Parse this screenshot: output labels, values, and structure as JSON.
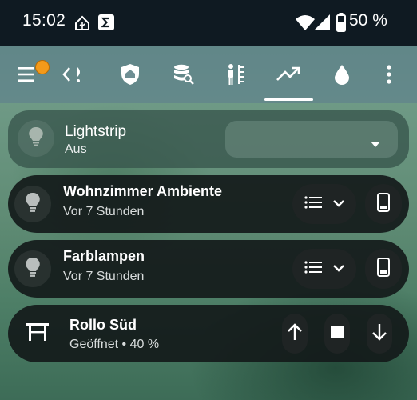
{
  "status_bar": {
    "time": "15:02",
    "battery_text": "50 %",
    "icons": [
      "home-assistant-icon",
      "sigma-app-icon",
      "wifi-icon",
      "cellular-signal-icon",
      "battery-icon"
    ]
  },
  "app_bar": {
    "tabs": [
      {
        "icon": "menu-icon",
        "has_badge": true
      },
      {
        "icon": "chevron-left-tab-icon"
      },
      {
        "icon": "shield-home-icon"
      },
      {
        "icon": "database-search-icon"
      },
      {
        "icon": "human-icon"
      },
      {
        "icon": "trending-up-icon",
        "selected": true
      },
      {
        "icon": "water-drop-icon"
      },
      {
        "icon": "more-vertical-icon"
      }
    ]
  },
  "cards": {
    "lightstrip": {
      "title": "Lightstrip",
      "state": "Aus",
      "dropdown_value": ""
    },
    "wohnzimmer": {
      "title": "Wohnzimmer Ambiente",
      "subtitle": "Vor 7 Stunden"
    },
    "farblampen": {
      "title": "Farblampen",
      "subtitle": "Vor 7 Stunden"
    },
    "rollo": {
      "title": "Rollo Süd",
      "subtitle": "Geöffnet • 40 %"
    }
  },
  "colors": {
    "accent_badge": "#f39a1a",
    "card_bg": "#141a1a",
    "status_bar_bg": "#0f1a22"
  }
}
